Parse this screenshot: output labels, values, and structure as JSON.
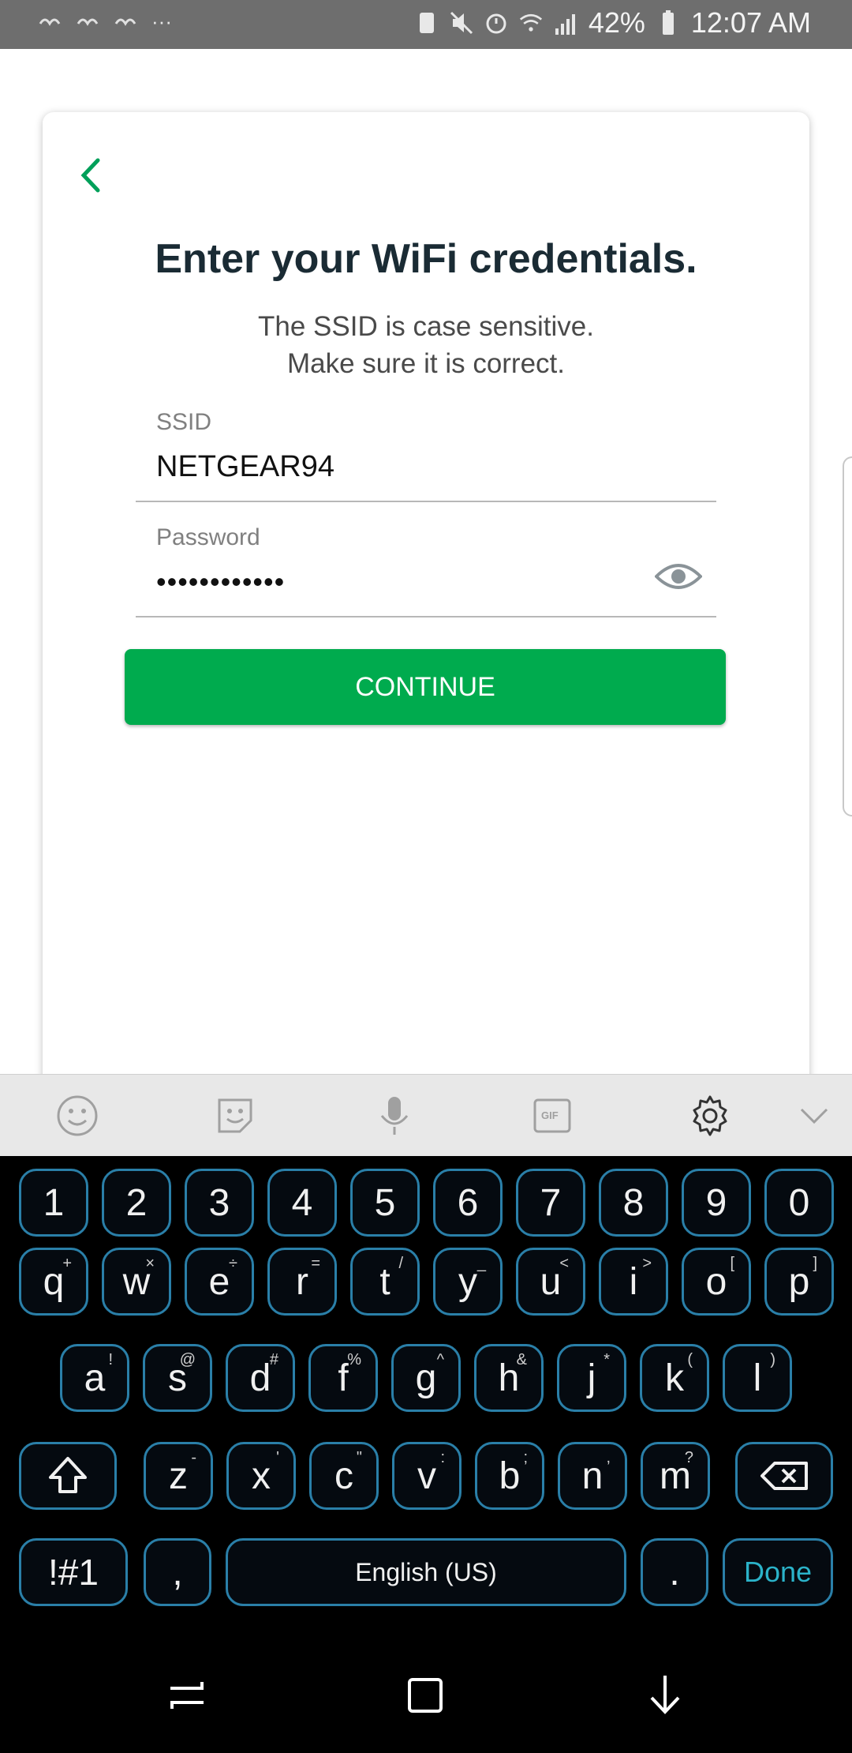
{
  "status_bar": {
    "dots": "···",
    "battery": "42%",
    "time": "12:07 AM"
  },
  "card": {
    "title": "Enter your WiFi credentials.",
    "subtitle_line1": "The SSID is case sensitive.",
    "subtitle_line2": "Make sure it is correct.",
    "ssid_label": "SSID",
    "ssid_value": "NETGEAR94",
    "password_label": "Password",
    "password_value": "••••••••••••",
    "continue_label": "CONTINUE"
  },
  "keyboard": {
    "row1": [
      "1",
      "2",
      "3",
      "4",
      "5",
      "6",
      "7",
      "8",
      "9",
      "0"
    ],
    "row2": [
      {
        "k": "q",
        "h": "+"
      },
      {
        "k": "w",
        "h": "×"
      },
      {
        "k": "e",
        "h": "÷"
      },
      {
        "k": "r",
        "h": "="
      },
      {
        "k": "t",
        "h": "/"
      },
      {
        "k": "y",
        "h": "_"
      },
      {
        "k": "u",
        "h": "<"
      },
      {
        "k": "i",
        "h": ">"
      },
      {
        "k": "o",
        "h": "["
      },
      {
        "k": "p",
        "h": "]"
      }
    ],
    "row3": [
      {
        "k": "a",
        "h": "!"
      },
      {
        "k": "s",
        "h": "@"
      },
      {
        "k": "d",
        "h": "#"
      },
      {
        "k": "f",
        "h": "%"
      },
      {
        "k": "g",
        "h": "^"
      },
      {
        "k": "h",
        "h": "&"
      },
      {
        "k": "j",
        "h": "*"
      },
      {
        "k": "k",
        "h": "("
      },
      {
        "k": "l",
        "h": ")"
      }
    ],
    "row4": [
      {
        "k": "z",
        "h": "-"
      },
      {
        "k": "x",
        "h": "'"
      },
      {
        "k": "c",
        "h": "\""
      },
      {
        "k": "v",
        "h": ":"
      },
      {
        "k": "b",
        "h": ";"
      },
      {
        "k": "n",
        "h": ","
      },
      {
        "k": "m",
        "h": "?"
      }
    ],
    "sym_label": "!#1",
    "comma_label": ",",
    "space_label": "English (US)",
    "period_label": ".",
    "done_label": "Done",
    "accent_color": "#2a7fa8",
    "done_color": "#2bb3c9"
  },
  "colors": {
    "primary_green": "#00ab4e",
    "back_arrow": "#00a05a"
  }
}
